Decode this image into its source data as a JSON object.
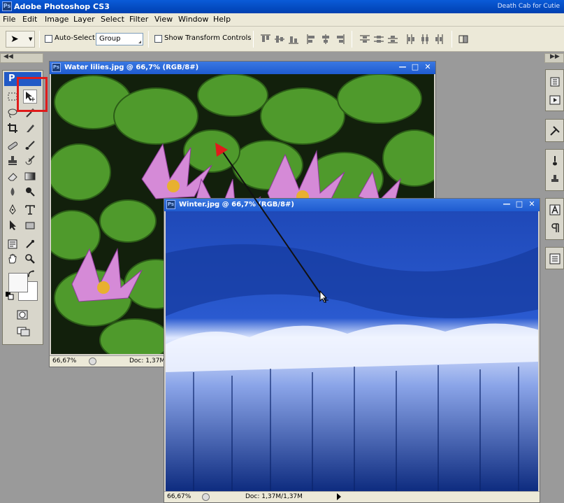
{
  "window": {
    "app_title": "Adobe Photoshop CS3",
    "logo_text": "Ps",
    "right_title": "Death Cab for Cutie"
  },
  "menu": [
    "File",
    "Edit",
    "Image",
    "Layer",
    "Select",
    "Filter",
    "View",
    "Window",
    "Help"
  ],
  "options_bar": {
    "auto_select_label": "Auto-Select:",
    "auto_select_value": "Group",
    "show_transform_label": "Show Transform Controls"
  },
  "tools_panel": {
    "header": "P",
    "active_tool": "move-tool"
  },
  "documents": [
    {
      "id": "water-lilies",
      "title": "Water lilies.jpg @ 66,7% (RGB/8#)",
      "zoom": "66,67%",
      "doc_info": "Doc: 1,37M"
    },
    {
      "id": "winter",
      "title": "Winter.jpg @ 66,7% (RGB/8#)",
      "zoom": "66,67%",
      "doc_info": "Doc: 1,37M/1,37M"
    }
  ],
  "colors": {
    "title_bar": "#0a5bd8",
    "highlight": "#e01b1b",
    "water_bg": "#1a2a10",
    "winter_bg": "#0d2f8a"
  }
}
